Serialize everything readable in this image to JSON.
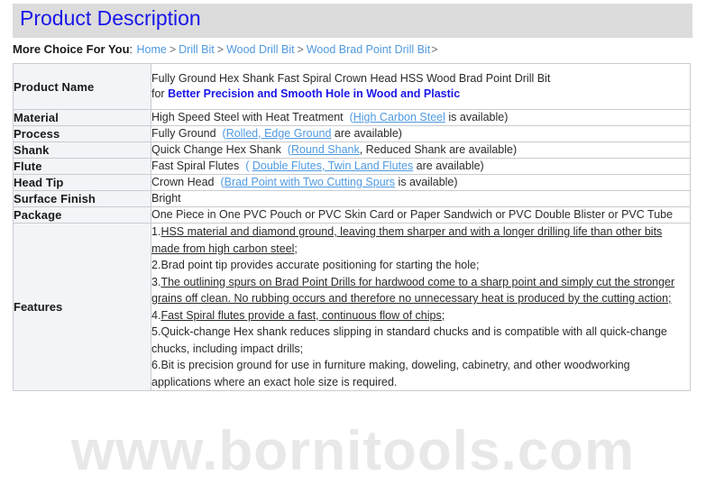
{
  "header": {
    "title": "Product Description",
    "bg_color": "#dcdcdc",
    "title_color": "#1a16e8"
  },
  "breadcrumb": {
    "label": "More Choice For You",
    "colon": ":",
    "items": [
      {
        "text": "Home"
      },
      {
        "text": "Drill Bit"
      },
      {
        "text": "Wood Drill Bit"
      },
      {
        "text": "Wood Brad Point Drill Bit"
      }
    ],
    "separator": ">",
    "trailing": ">",
    "link_color": "#4f9ae0"
  },
  "spec_rows": [
    {
      "label": "Product Name",
      "line1": "Fully Ground Hex Shank Fast Spiral Crown Head HSS Wood Brad Point Drill Bit",
      "line2_prefix": "for ",
      "line2_highlight": "Better Precision and Smooth Hole in Wood and Plastic"
    },
    {
      "label": "Material",
      "pre": "High Speed Steel with Heat Treatment",
      "paren_open": "(",
      "link": "High Carbon Steel",
      "post": " is available)"
    },
    {
      "label": "Process",
      "pre": "Fully Ground",
      "paren_open": "(",
      "link": "Rolled, Edge Ground",
      "post": " are available)"
    },
    {
      "label": "Shank",
      "pre": "Quick Change Hex Shank",
      "paren_open": "(",
      "link": "Round Shank",
      "post": ", Reduced Shank are  available)"
    },
    {
      "label": "Flute",
      "pre": "Fast Spiral Flutes",
      "paren_open": "( ",
      "link": "Double Flutes, Twin Land Flutes",
      "post": " are available)"
    },
    {
      "label": "Head Tip",
      "pre": "Crown Head",
      "paren_open": "(",
      "link": "Brad Point with Two Cutting Spurs",
      "post": " is available)"
    },
    {
      "label": "Surface Finish",
      "pre": "Bright",
      "paren_open": "",
      "link": "",
      "post": ""
    },
    {
      "label": "Package",
      "pre": "One Piece in One PVC Pouch or PVC Skin Card  or Paper Sandwich  or PVC Double Blister or PVC Tube",
      "paren_open": "",
      "link": "",
      "post": ""
    }
  ],
  "features": {
    "label": "Features",
    "lines": [
      {
        "num": "1.",
        "text": "HSS material and diamond ground, leaving them sharper and with a longer drilling life than other bits",
        "underline": true
      },
      {
        "num": "",
        "text": "made from high carbon steel;",
        "underline": true
      },
      {
        "num": "2.",
        "text": "Brad point tip provides accurate positioning for starting the hole;",
        "underline": false
      },
      {
        "num": "3.",
        "text": "The outlining spurs on Brad Point Drills for hardwood come to a sharp point and simply cut the stronger",
        "underline": true
      },
      {
        "num": "",
        "text": "grains off clean. No rubbing occurs and therefore no unnecessary heat is produced by the cutting action;",
        "underline": true
      },
      {
        "num": "4.",
        "text": "Fast Spiral flutes provide a fast, continuous flow of chips;",
        "underline": true
      },
      {
        "num": "5.",
        "text": "Quick-change Hex shank reduces slipping in standard chucks and is compatible with all quick-change",
        "underline": false
      },
      {
        "num": "",
        "text": "chucks, including impact drills;",
        "underline": false
      },
      {
        "num": "6.",
        "text": "Bit is precision ground for use in furniture making, doweling, cabinetry, and other woodworking",
        "underline": false
      },
      {
        "num": "",
        "text": "applications where an exact hole size is required.",
        "underline": false
      }
    ]
  },
  "watermark": {
    "text": "www.bornitools.com"
  }
}
